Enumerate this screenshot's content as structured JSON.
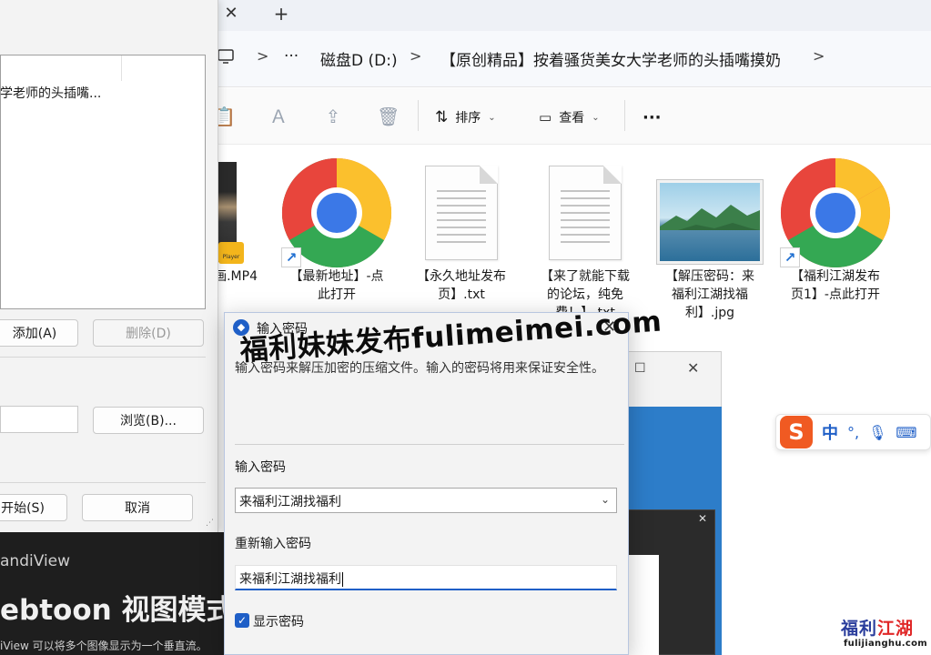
{
  "explorer": {
    "address": {
      "overflow": "···",
      "drive": "磁盘D (D:)",
      "folder": "【原创精品】按着骚货美女大学老师的头插嘴摸奶",
      "separator": ">"
    },
    "toolbar": {
      "sort_label": "排序",
      "view_label": "查看",
      "more_label": "···"
    },
    "files": [
      {
        "name": "...画.MP4",
        "label_line1": "画.MP4",
        "label_line2": "",
        "label_line3": "",
        "icon": "video-thumbnail-icon"
      },
      {
        "name": "【最新地址】-点此打开",
        "label_line1": "【最新地址】-点",
        "label_line2": "此打开",
        "label_line3": "",
        "icon": "chrome-icon"
      },
      {
        "name": "【永久地址发布页】.txt",
        "label_line1": "【永久地址发布",
        "label_line2": "页】.txt",
        "label_line3": "",
        "icon": "text-file-icon"
      },
      {
        "name": "【来了就能下载的论坛，纯免费】...",
        "label_line1": "【来了就能下载",
        "label_line2": "的论坛，纯免",
        "label_line3": "费！】.txt",
        "icon": "text-file-icon"
      },
      {
        "name": "【解压密码：来福利江湖找福利】.jpg",
        "label_line1": "【解压密码：来",
        "label_line2": "福利江湖找福",
        "label_line3": "利】.jpg",
        "icon": "image-file-icon"
      },
      {
        "name": "【福利江湖发布页1】-点此打开",
        "label_line1": "【福利江湖发布",
        "label_line2": "页1】-点此打开",
        "label_line3": "",
        "icon": "chrome-icon"
      }
    ]
  },
  "archive_dialog": {
    "list_row": "学老师的头插嘴...",
    "add_button": "添加(A)",
    "delete_button": "删除(D)",
    "browse_button": "浏览(B)...",
    "start_button": "开始(S)",
    "cancel_button": "取消"
  },
  "banner": {
    "app_name": "andiView",
    "headline": "ebtoon 视图模式",
    "caption": "iView 可以将多个图像显示为一个垂直流。"
  },
  "password_dialog": {
    "title": "输入密码",
    "description": "输入密码来解压加密的压缩文件。输入的密码将用来保证安全性。",
    "password_label": "输入密码",
    "password_value": "来福利江湖找福利",
    "confirm_label": "重新输入密码",
    "confirm_value": "来福利江湖找福利",
    "show_password_label": "显示密码",
    "show_password_checked": true
  },
  "watermark": {
    "text": "福利妹妹发布fulimeimei.com"
  },
  "ime": {
    "mode": "中",
    "punct": "°,"
  },
  "corner_logo": {
    "text_left": "福利",
    "text_right": "江湖",
    "url": "fulijianghu.com"
  },
  "colors": {
    "accent": "#1f5fc7",
    "ime_orange": "#f05a22",
    "logo_blue": "#2a3d9c",
    "logo_red": "#e02828"
  }
}
